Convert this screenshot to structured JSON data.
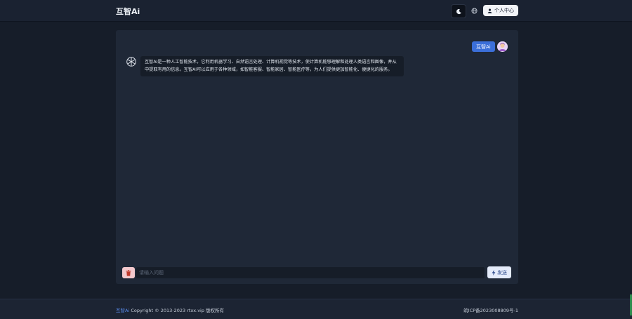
{
  "header": {
    "brand": "互智Ai",
    "theme_toggle_icon": "moon-icon",
    "language_icon": "globe-icon",
    "user_center_label": "个人中心"
  },
  "chat": {
    "user_message": "互智Ai",
    "ai_message": "互智AI是一种人工智能技术，它利用机器学习、自然语言处理、计算机视觉等技术，使计算机能够理解和处理人类语言和图像，并从中提取有用的信息。互智AI可以应用于各种领域，如智能客服、智能家居、智能医疗等，为人们提供更加智能化、便捷化的服务。"
  },
  "composer": {
    "placeholder": "请输入问题",
    "value": "",
    "send_label": "发送"
  },
  "footer": {
    "brand": "互智Ai",
    "copyright": " Copyright © 2013-2023 rtxx.vip 版权所有",
    "icp": "皖ICP备2023008809号-1"
  },
  "colors": {
    "background": "#161d29",
    "panel": "#1f2837",
    "accent": "#3b6fd9",
    "trash_button": "#f3c9cd"
  }
}
